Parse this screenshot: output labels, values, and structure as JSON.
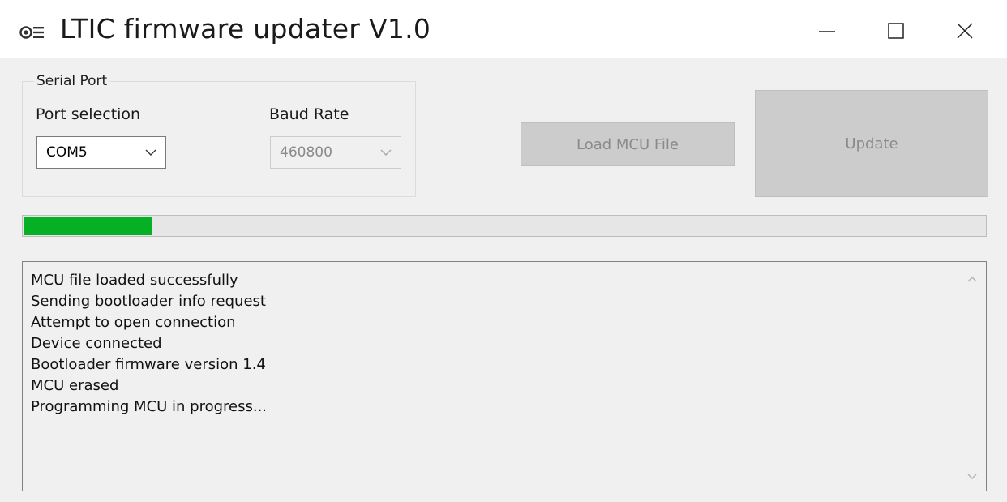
{
  "window": {
    "title": "LTIC firmware updater V1.0",
    "icons": {
      "app": "app-icon",
      "minimize": "minimize-icon",
      "maximize": "maximize-icon",
      "close": "close-icon"
    }
  },
  "serial_port": {
    "group_label": "Serial Port",
    "port_label": "Port selection",
    "port_value": "COM5",
    "baud_label": "Baud Rate",
    "baud_value": "460800"
  },
  "buttons": {
    "load": "Load MCU File",
    "update": "Update"
  },
  "progress": {
    "fraction": 0.133,
    "color": "#06b025"
  },
  "log": {
    "lines": [
      "MCU file loaded successfully",
      "Sending bootloader info request",
      "Attempt to open connection",
      "Device connected",
      "Bootloader firmware version 1.4",
      "MCU erased",
      "Programming MCU in progress..."
    ]
  }
}
